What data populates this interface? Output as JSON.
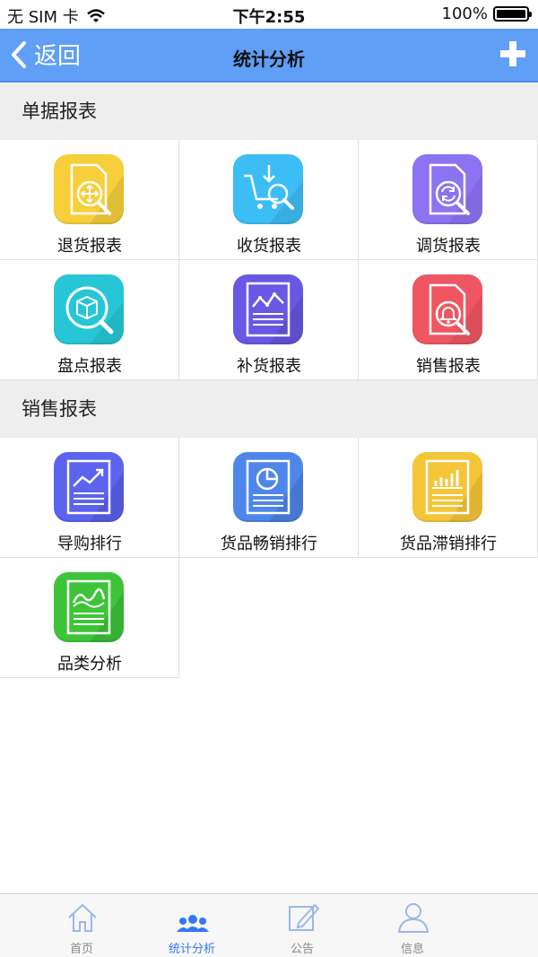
{
  "status_bar": {
    "carrier": "无 SIM 卡",
    "time": "下午2:55",
    "battery": "100%",
    "battery_level": 1.0
  },
  "nav": {
    "back_label": "返回",
    "title": "统计分析"
  },
  "sections": [
    {
      "title": "单据报表",
      "items": [
        {
          "label": "退货报表",
          "icon": "move-document-icon",
          "color": "#f6cf3b"
        },
        {
          "label": "收货报表",
          "icon": "cart-search-icon",
          "color": "#3cbdf5"
        },
        {
          "label": "调货报表",
          "icon": "refresh-document-icon",
          "color": "#8a74f2"
        },
        {
          "label": "盘点报表",
          "icon": "box-search-icon",
          "color": "#27c6d6"
        },
        {
          "label": "补货报表",
          "icon": "line-chart-document-icon",
          "color": "#6a57e3"
        },
        {
          "label": "销售报表",
          "icon": "bell-document-icon",
          "color": "#ef5662"
        }
      ]
    },
    {
      "title": "销售报表",
      "items": [
        {
          "label": "导购排行",
          "icon": "trend-document-icon",
          "color": "#5c63ee"
        },
        {
          "label": "货品畅销排行",
          "icon": "pie-document-icon",
          "color": "#4f86ea"
        },
        {
          "label": "货品滞销排行",
          "icon": "bar-chart-document-icon",
          "color": "#f5c538"
        },
        {
          "label": "品类分析",
          "icon": "area-chart-document-icon",
          "color": "#3ec439"
        }
      ]
    }
  ],
  "tabbar": {
    "items": [
      {
        "label": "首页",
        "icon": "home-icon",
        "active": false
      },
      {
        "label": "统计分析",
        "icon": "people-icon",
        "active": true
      },
      {
        "label": "公告",
        "icon": "edit-icon",
        "active": false
      },
      {
        "label": "信息",
        "icon": "user-icon",
        "active": false
      }
    ],
    "active_color": "#3478f6",
    "inactive_color": "#888888"
  },
  "colors": {
    "nav_bg": "#5f9ff6",
    "section_bg": "#eeeeee"
  }
}
